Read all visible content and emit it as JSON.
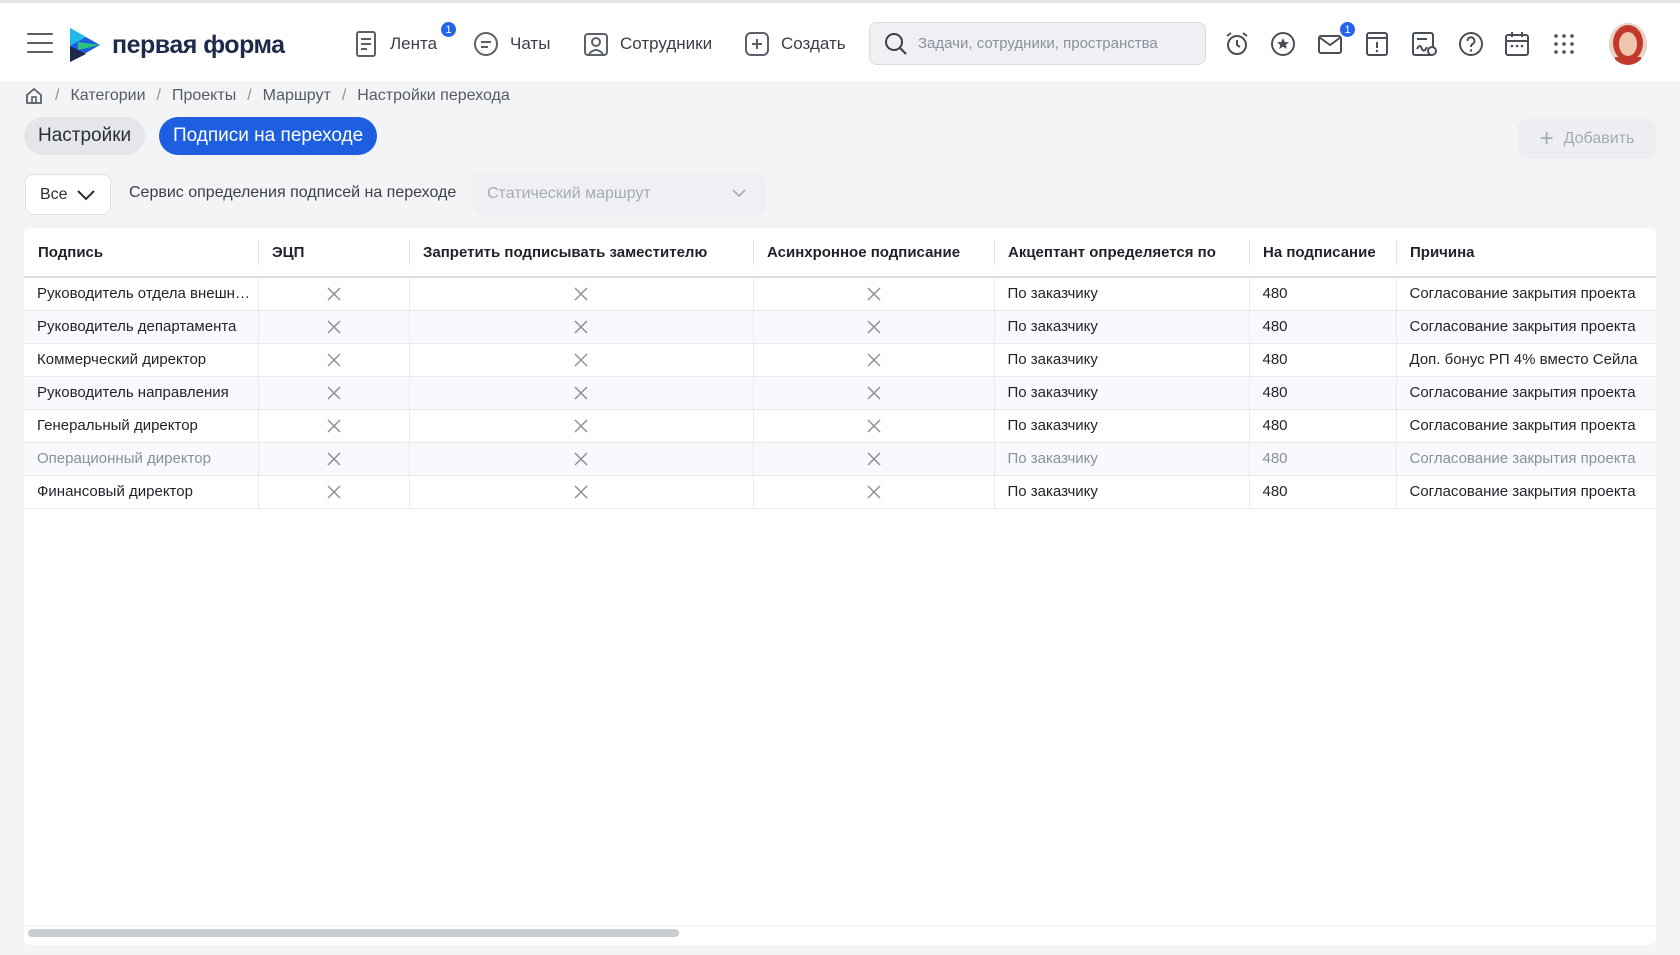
{
  "header": {
    "logo_text": "первая форма",
    "nav": [
      {
        "label": "Лента",
        "icon": "feed-icon",
        "badge": "1"
      },
      {
        "label": "Чаты",
        "icon": "chat-icon"
      },
      {
        "label": "Сотрудники",
        "icon": "employees-icon"
      },
      {
        "label": "Создать",
        "icon": "plus-square-icon"
      }
    ],
    "search_placeholder": "Задачи, сотрудники, пространства",
    "mail_badge": "1",
    "tools": [
      "alarm-clock-icon",
      "star-chat-icon",
      "mail-alert-icon",
      "task-alert-icon",
      "sign-document-icon",
      "help-icon",
      "calendar-icon",
      "apps-grid-icon"
    ]
  },
  "breadcrumb": [
    "Категории",
    "Проекты",
    "Маршрут",
    "Настройки перехода"
  ],
  "tabs": {
    "settings": "Настройки",
    "signatures": "Подписи на переходе"
  },
  "add_button": "Добавить",
  "filters": {
    "all": "Все",
    "service_label": "Сервис определения подписей на переходе",
    "service_value": "Статический маршрут"
  },
  "table": {
    "columns": [
      "Подпись",
      "ЭЦП",
      "Запретить подписывать заместителю",
      "Асинхронное подписание",
      "Акцептант определяется по",
      "На подписание",
      "Причина"
    ],
    "rows": [
      {
        "signer": "Руководитель отдела внешних коммуникаций",
        "accept": "По заказчику",
        "time": "480",
        "reason": "Согласование закрытия проекта",
        "dim": false
      },
      {
        "signer": "Руководитель департамента",
        "accept": "По заказчику",
        "time": "480",
        "reason": "Согласование закрытия проекта",
        "dim": false
      },
      {
        "signer": "Коммерческий директор",
        "accept": "По заказчику",
        "time": "480",
        "reason": "Доп. бонус РП 4% вместо Сейла",
        "dim": false
      },
      {
        "signer": "Руководитель направления",
        "accept": "По заказчику",
        "time": "480",
        "reason": "Согласование закрытия проекта",
        "dim": false
      },
      {
        "signer": "Генеральный директор",
        "accept": "По заказчику",
        "time": "480",
        "reason": "Согласование закрытия проекта",
        "dim": false
      },
      {
        "signer": "Операционный директор",
        "accept": "По заказчику",
        "time": "480",
        "reason": "Согласование закрытия проекта",
        "dim": true
      },
      {
        "signer": "Финансовый директор",
        "accept": "По заказчику",
        "time": "480",
        "reason": "Согласование закрытия проекта",
        "dim": false
      }
    ]
  },
  "colors": {
    "accent": "#1d5fe0",
    "badge": "#2563eb",
    "logo_dark": "#1e2a4a"
  }
}
